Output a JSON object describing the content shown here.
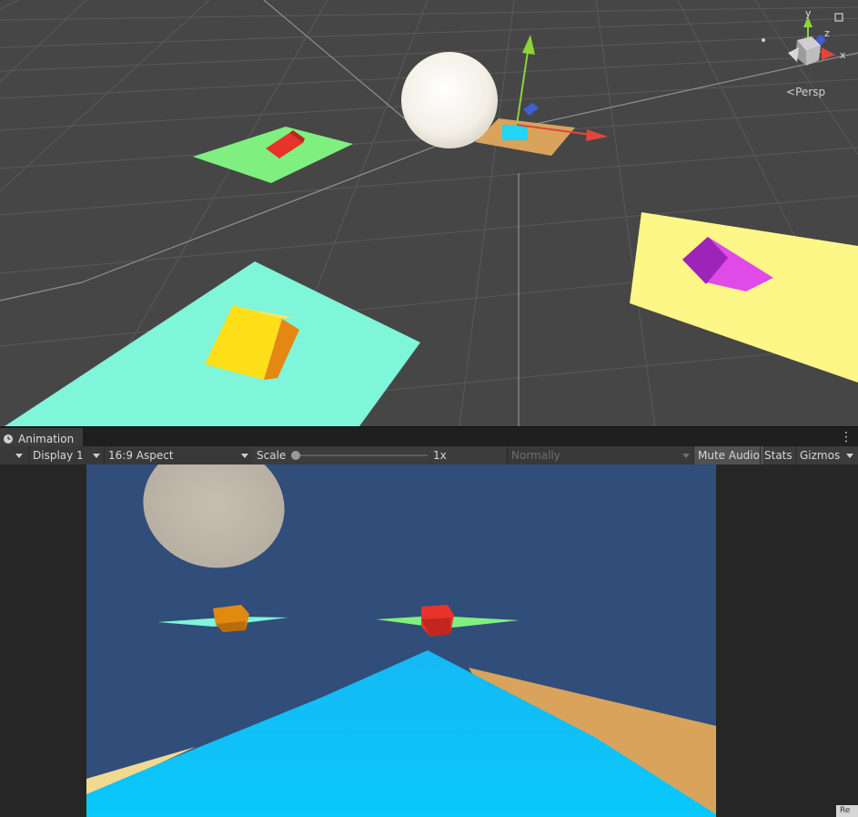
{
  "scene": {
    "projection_label": "Persp",
    "gizmo_axes": {
      "x": "x",
      "y": "y",
      "z": "z"
    }
  },
  "game_tab": {
    "label": "Animation"
  },
  "toolbar": {
    "display": "Display 1",
    "aspect": "16:9 Aspect",
    "scale_label": "Scale",
    "scale_value": "1x",
    "playmode": "Normally",
    "mute_audio": "Mute Audio",
    "stats": "Stats",
    "gizmos": "Gizmos"
  },
  "corner_badge": "Re",
  "colors": {
    "scene_bg": "#454545",
    "game_sky": "#314d79",
    "cyan_plane": "#7ff5d9",
    "green_plane": "#7ff07f",
    "yellow_plane": "#fdf787",
    "orange_plane": "#d9a35c",
    "magenta_cube": "#cc3fe0",
    "yellow_cube": "#ffd80f"
  }
}
